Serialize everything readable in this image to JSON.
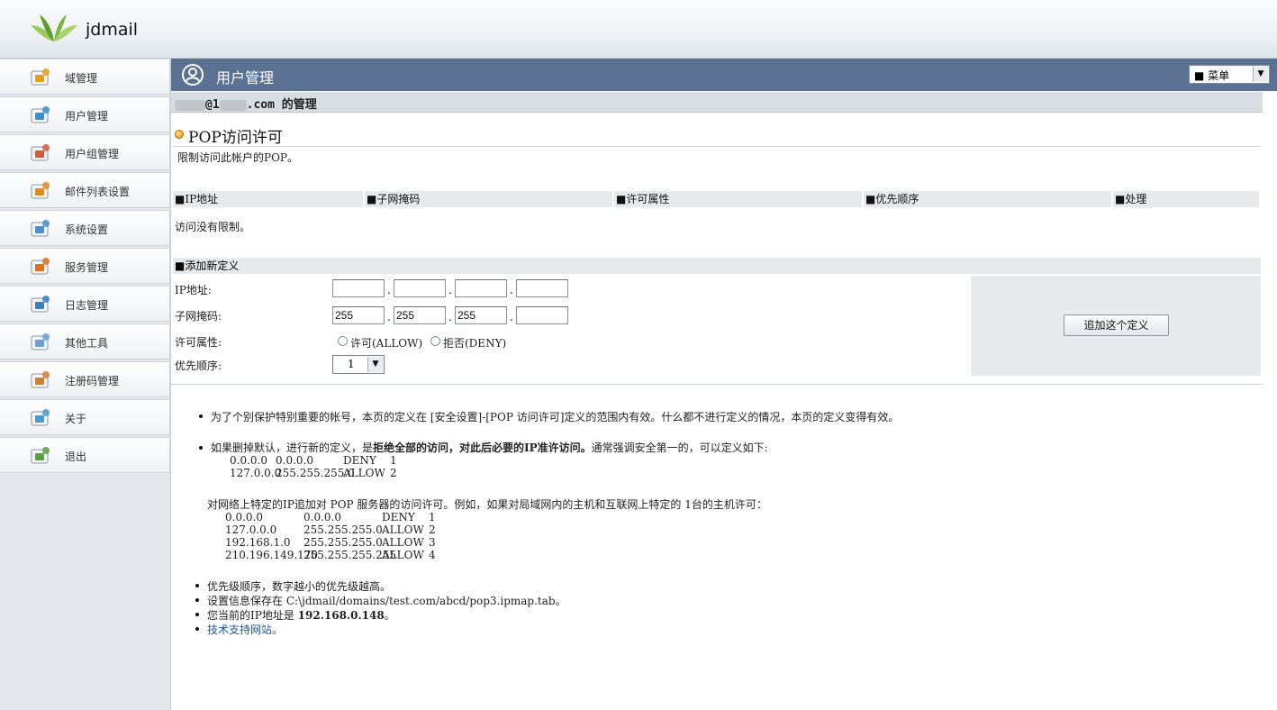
{
  "app": {
    "brand": "jdmail"
  },
  "sidebar": {
    "items": [
      {
        "label": "域管理",
        "icon": "domain-icon"
      },
      {
        "label": "用户管理",
        "icon": "user-icon"
      },
      {
        "label": "用户组管理",
        "icon": "group-icon"
      },
      {
        "label": "邮件列表设置",
        "icon": "mailing-list-icon"
      },
      {
        "label": "系统设置",
        "icon": "system-settings-icon"
      },
      {
        "label": "服务管理",
        "icon": "service-icon"
      },
      {
        "label": "日志管理",
        "icon": "log-icon"
      },
      {
        "label": "其他工具",
        "icon": "tools-icon"
      },
      {
        "label": "注册码管理",
        "icon": "license-icon"
      },
      {
        "label": "关于",
        "icon": "about-icon"
      },
      {
        "label": "退出",
        "icon": "logout-icon"
      }
    ]
  },
  "header": {
    "title": "用户管理",
    "menu_label": "■ 菜单"
  },
  "account": {
    "at": "@1",
    "suffix": ".com 的管理"
  },
  "section": {
    "title": "POP访问许可",
    "description": "限制访问此帐户的POP。",
    "columns": [
      "■IP地址",
      "■子网掩码",
      "■许可属性",
      "■优先顺序",
      "■处理"
    ],
    "empty_text": "访问没有限制。"
  },
  "form": {
    "heading": "■添加新定义",
    "ip_label": "IP地址:",
    "ip_values": [
      "",
      "",
      "",
      ""
    ],
    "mask_label": "子网掩码:",
    "mask_values": [
      "255",
      "255",
      "255",
      ""
    ],
    "attr_label": "许可属性:",
    "allow_label": "许可(ALLOW)",
    "deny_label": "拒否(DENY)",
    "priority_label": "优先顺序:",
    "priority_value": "1",
    "submit_label": "追加这个定义"
  },
  "notes": {
    "n1": "为了个别保护特别重要的帐号，本页的定义在 [安全设置]-[POP 访问许可]定义的范围内有效。什么都不进行定义的情况，本页的定义变得有效。",
    "n2_a": "如果删掉默认，进行新的定义，是",
    "n2_b": "拒绝全部的访问，对此后必要的IP准许访问。",
    "n2_c": "通常强调安全第一的，可以定义如下:",
    "example1": [
      [
        "0.0.0.0",
        "0.0.0.0",
        "DENY",
        "1"
      ],
      [
        "127.0.0.0",
        "255.255.255.0",
        "ALLOW",
        "2"
      ]
    ],
    "n3": "对网络上特定的IP追加对 POP 服务器的访问许可。例如，如果对局域网内的主机和互联网上特定的 1台的主机许可：",
    "example2": [
      [
        "0.0.0.0",
        "0.0.0.0",
        "DENY",
        "1"
      ],
      [
        "127.0.0.0",
        "255.255.255.0",
        "ALLOW",
        "2"
      ],
      [
        "192.168.1.0",
        "255.255.255.0",
        "ALLOW",
        "3"
      ],
      [
        "210.196.149.170",
        "255.255.255.255",
        "ALLOW",
        "4"
      ]
    ],
    "n4": "优先级顺序，数字越小的优先级越高。",
    "n5_a": "设置信息保存在 ",
    "n5_b": "C:\\jdmail/domains/test.com/abcd/pop3.ipmap.tab",
    "n5_c": "。",
    "n6_a": "您当前的IP地址是 ",
    "n6_b": "192.168.0.148",
    "n6_c": "。",
    "n7": "技术支持网站。"
  },
  "colors": {
    "titlebar": "#5a7192",
    "sidebar": "#e4e8ec",
    "link": "#1f5aa0"
  }
}
